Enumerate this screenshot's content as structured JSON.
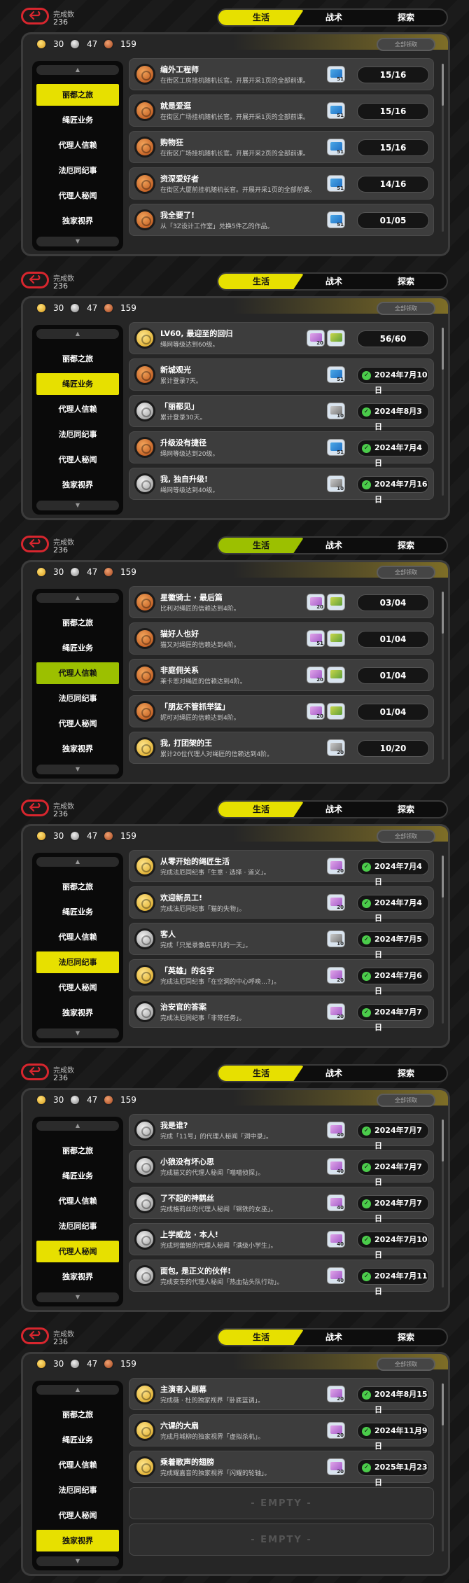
{
  "header": {
    "done_label": "完成数",
    "done_count": "236",
    "back_icon": "back-arrow-icon",
    "tabs": [
      "生活",
      "战术",
      "探索"
    ]
  },
  "currency": {
    "gold": "30",
    "silver": "47",
    "bronze": "159"
  },
  "claim_all_label": "全部领取",
  "sidebar_items": [
    "丽都之旅",
    "绳匠业务",
    "代理人信赖",
    "法厄同纪事",
    "代理人秘闻",
    "独家视界"
  ],
  "sections": [
    {
      "tab_color": "#e7e000",
      "active": 0,
      "rows": [
        {
          "badge": "c",
          "title": "编外工程师",
          "desc": "在街区工房挂机随机长官。开展开采1页的全部前课。",
          "reward": "51",
          "rtype": "b",
          "status": "15/16",
          "kind": "progress"
        },
        {
          "badge": "c",
          "title": "就是爱逛",
          "desc": "在街区广场挂机随机长官。开展开采1页的全部前课。",
          "reward": "51",
          "rtype": "b",
          "status": "15/16",
          "kind": "progress"
        },
        {
          "badge": "c",
          "title": "购物狂",
          "desc": "在街区广场挂机随机长官。开展开采2页的全部前课。",
          "reward": "51",
          "rtype": "b",
          "status": "15/16",
          "kind": "progress"
        },
        {
          "badge": "c",
          "title": "资深爱好者",
          "desc": "在街区大厦前挂机随机长官。开展开采1页的全部前课。",
          "reward": "51",
          "rtype": "b",
          "status": "14/16",
          "kind": "progress"
        },
        {
          "badge": "c",
          "title": "我全要了!",
          "desc": "从「3Z设计工作室」兑换5件乙的作品。",
          "reward": "51",
          "rtype": "b",
          "status": "01/05",
          "kind": "progress"
        }
      ]
    },
    {
      "tab_color": "#e7e000",
      "active": 1,
      "rows": [
        {
          "badge": "g",
          "title": "LV60, 最迎至的回归",
          "desc": "绳网等级达到60级。",
          "reward": "20",
          "rtype": "sq",
          "extra": true,
          "status": "56/60",
          "kind": "progress"
        },
        {
          "badge": "c",
          "title": "新城观光",
          "desc": "累计登录7天。",
          "reward": "51",
          "rtype": "b",
          "status": "2024年7月10日",
          "kind": "date"
        },
        {
          "badge": "s",
          "title": "「丽都见」",
          "desc": "累计登录30天。",
          "reward": "10",
          "rtype": "ph",
          "status": "2024年8月3日",
          "kind": "date"
        },
        {
          "badge": "c",
          "title": "升级没有捷径",
          "desc": "绳网等级达到20级。",
          "reward": "51",
          "rtype": "b",
          "status": "2024年7月4日",
          "kind": "date"
        },
        {
          "badge": "s",
          "title": "我, 独自升级!",
          "desc": "绳网等级达到40级。",
          "reward": "10",
          "rtype": "ph",
          "status": "2024年7月16日",
          "kind": "date"
        }
      ]
    },
    {
      "tab_color": "#9cc000",
      "active": 2,
      "rows": [
        {
          "badge": "c",
          "title": "星徽骑士 · 最后篇",
          "desc": "比利对绳匠的信赖达到4阶。",
          "reward": "20",
          "rtype": "sq",
          "extra": true,
          "status": "03/04",
          "kind": "progress"
        },
        {
          "badge": "c",
          "title": "猫好人也好",
          "desc": "猫又对绳匠的信赖达到4阶。",
          "reward": "51",
          "rtype": "sq",
          "extra": true,
          "status": "01/04",
          "kind": "progress"
        },
        {
          "badge": "c",
          "title": "非庭佣关系",
          "desc": "莱卡恩对绳匠的信赖达到4阶。",
          "reward": "20",
          "rtype": "sq",
          "extra": true,
          "status": "01/04",
          "kind": "progress"
        },
        {
          "badge": "c",
          "title": "「朋友不管抓举猛」",
          "desc": "妮可对绳匠的信赖达到4阶。",
          "reward": "20",
          "rtype": "sq",
          "extra": true,
          "status": "01/04",
          "kind": "progress"
        },
        {
          "badge": "g",
          "title": "我, 打团架的王",
          "desc": "累计20位代理人对绳匠的信赖达到4阶。",
          "reward": "20",
          "rtype": "ph",
          "status": "10/20",
          "kind": "progress"
        }
      ]
    },
    {
      "tab_color": "#e7e000",
      "active": 3,
      "rows": [
        {
          "badge": "g",
          "title": "从零开始的绳匠生活",
          "desc": "完成法厄同纪事「生意 · 选择 · 道义」。",
          "reward": "20",
          "rtype": "sq",
          "status": "2024年7月4日",
          "kind": "date"
        },
        {
          "badge": "g",
          "title": "欢迎新员工!",
          "desc": "完成法厄同纪事「猫的失物」。",
          "reward": "20",
          "rtype": "sq",
          "status": "2024年7月4日",
          "kind": "date"
        },
        {
          "badge": "s",
          "title": "客人",
          "desc": "完成「只是录像店平凡的一天」。",
          "reward": "10",
          "rtype": "ph",
          "status": "2024年7月5日",
          "kind": "date"
        },
        {
          "badge": "g",
          "title": "「英雄」的名字",
          "desc": "完成法厄同纪事「在空洞的中心呼唤…?」。",
          "reward": "20",
          "rtype": "sq",
          "status": "2024年7月6日",
          "kind": "date"
        },
        {
          "badge": "s",
          "title": "治安官的答案",
          "desc": "完成法厄同纪事「非常任务」。",
          "reward": "20",
          "rtype": "sq",
          "status": "2024年7月7日",
          "kind": "date"
        }
      ]
    },
    {
      "tab_color": "#e7e000",
      "active": 4,
      "rows": [
        {
          "badge": "s",
          "title": "我是谁?",
          "desc": "完成「11号」的代理人秘闻「洞中录」。",
          "reward": "40",
          "rtype": "sq",
          "status": "2024年7月7日",
          "kind": "date"
        },
        {
          "badge": "s",
          "title": "小狼没有坏心思",
          "desc": "完成猫又的代理人秘闻「喵喵侦探」。",
          "reward": "40",
          "rtype": "sq",
          "status": "2024年7月7日",
          "kind": "date"
        },
        {
          "badge": "s",
          "title": "了不起的神鹤丝",
          "desc": "完成格莉丝的代理人秘闻「钢铁的女巫」。",
          "reward": "40",
          "rtype": "sq",
          "status": "2024年7月7日",
          "kind": "date"
        },
        {
          "badge": "s",
          "title": "上学威龙 · 本人!",
          "desc": "完成珂蕾妲的代理人秘闻「满级小学生」。",
          "reward": "40",
          "rtype": "sq",
          "status": "2024年7月10日",
          "kind": "date"
        },
        {
          "badge": "s",
          "title": "面包, 是正义的伙伴!",
          "desc": "完成安东的代理人秘闻「热血钻头队行动」。",
          "reward": "40",
          "rtype": "sq",
          "status": "2024年7月11日",
          "kind": "date"
        }
      ]
    },
    {
      "tab_color": "#e7e000",
      "active": 5,
      "rows": [
        {
          "badge": "g",
          "title": "主演者入剧幕",
          "desc": "完成薇 · 杜的独家视界「卧底蓝调」。",
          "reward": "20",
          "rtype": "sq",
          "status": "2024年8月15日",
          "kind": "date"
        },
        {
          "badge": "g",
          "title": "六课的大扇",
          "desc": "完成月城柳的独家视界「虚拟杀机」。",
          "reward": "20",
          "rtype": "sq",
          "status": "2024年11月9日",
          "kind": "date"
        },
        {
          "badge": "g",
          "title": "乘着歌声的翅膀",
          "desc": "完成耀嘉音的独家视界「闪耀的轮轴」。",
          "reward": "20",
          "rtype": "sq",
          "status": "2025年1月23日",
          "kind": "date"
        },
        {
          "empty": true,
          "label": "- EMPTY -"
        },
        {
          "empty": true,
          "label": "- EMPTY -"
        }
      ]
    }
  ]
}
